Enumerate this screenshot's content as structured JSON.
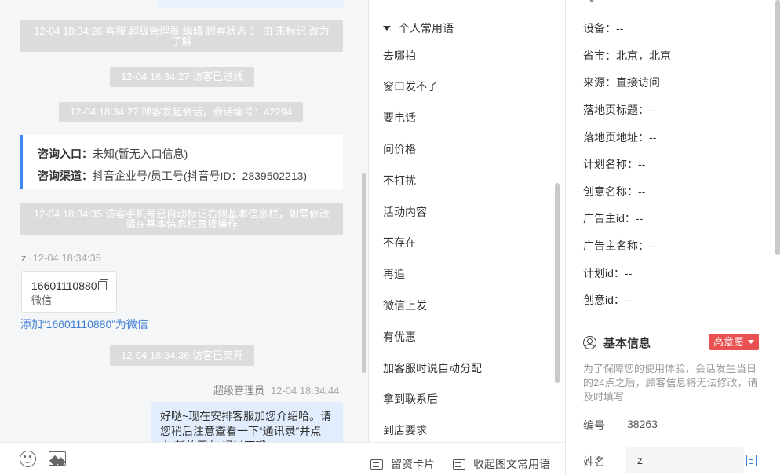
{
  "chat": {
    "system_messages": [
      {
        "text": "12-04 18:34:26 客服 超级管理员 编辑 顾客状态 ： 由 未标记 改为 了解"
      },
      {
        "text": "12-04 18:34:27 访客已进线"
      },
      {
        "text": "12-04 18:34:27 顾客发起会话，会话编号：42294"
      },
      {
        "text": "12-04 18:34:35 访客手机号已自动标记右侧基本信息栏，如需修改请在基本信息栏直接操作"
      },
      {
        "text": "12-04 18:34:36 访客已离开"
      }
    ],
    "entry_card": {
      "entry_label": "咨询入口：",
      "entry_value": "未知(暂无入口信息)",
      "channel_label": "咨询渠道：",
      "channel_value": "抖音企业号/员工号(抖音号ID：2839502213)"
    },
    "visitor": {
      "name": "z",
      "time": "12-04 18:34:35"
    },
    "phone_card": {
      "number": "16601110880",
      "type": "微信"
    },
    "add_wechat_link": "添加“16601110880”为微信",
    "agent": {
      "name": "超级管理员",
      "time": "12-04 18:34:44"
    },
    "agent_message": "好哒~现在安排客服加您介绍哈。请您稍后注意查看一下“通讯录”并点击“新的朋友”通过下哦"
  },
  "phrases": {
    "group_title": "个人常用语",
    "items": [
      "去哪拍",
      "窗口发不了",
      "要电话",
      "问价格",
      "不打扰",
      "活动内容",
      "不存在",
      "再追",
      "微信上发",
      "有优惠",
      "加客服时说自动分配",
      "拿到联系后",
      "到店要求"
    ],
    "bottom_actions": {
      "lead_card": "留资卡片",
      "collapse": "收起图文常用语"
    }
  },
  "info": {
    "rows": [
      {
        "label": "设备：",
        "value": "--"
      },
      {
        "label": "省市：",
        "value": "北京，北京"
      },
      {
        "label": "来源：",
        "value": "直接访问"
      },
      {
        "label": "落地页标题：",
        "value": "--"
      },
      {
        "label": "落地页地址：",
        "value": "--"
      },
      {
        "label": "计划名称：",
        "value": "--"
      },
      {
        "label": "创意名称：",
        "value": "--"
      },
      {
        "label": "广告主id：",
        "value": "--"
      },
      {
        "label": "广告主名称：",
        "value": "--"
      },
      {
        "label": "计划id：",
        "value": "--"
      },
      {
        "label": "创意id：",
        "value": "--"
      }
    ],
    "basic": {
      "title": "基本信息",
      "intent": "高意愿",
      "notice": "为了保障您的使用体验，会话发生当日的24点之后，顾客信息将无法修改，请及时填写",
      "id_label": "编号",
      "id_value": "38263",
      "name_label": "姓名",
      "name_value": "z"
    }
  },
  "colors": {
    "accent_blue": "#3d8bf2",
    "link_blue": "#3d7ed6",
    "intent_red": "#e95151",
    "outgoing_bubble": "#e1ecfc"
  }
}
